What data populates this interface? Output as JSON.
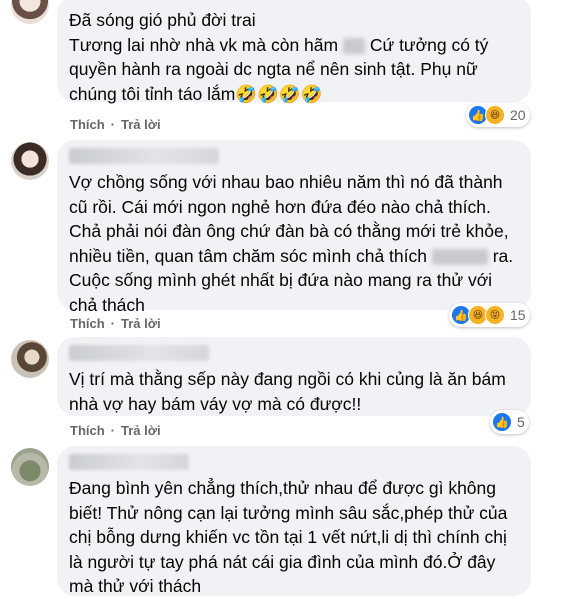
{
  "comments": [
    {
      "text_lines": [
        "Đã sóng gió phủ đời trai",
        "Tương lai nhờ nhà vk mà còn hãm",
        "Cứ tưởng có tý",
        "quyền hành ra ngoài dc ngta nể nên sinh tật. Phụ nữ",
        "chúng tôi tỉnh táo lắm🤣🤣🤣🤣"
      ],
      "like_label": "Thích",
      "reply_label": "Trả lời",
      "reaction_count": "20",
      "reactions": [
        "like-icon",
        "haha-icon"
      ]
    },
    {
      "text_lines": [
        "Vợ chồng sống với nhau bao nhiêu năm thì nó đã thành",
        "cũ rồi. Cái mới ngon nghẻ hơn đứa đéo nào chả thích.",
        "Chả phải nói đàn ông chứ đàn bà có thằng mới trẻ khỏe,",
        "nhiều tiền, quan tâm chăm sóc mình chả thích",
        "ra.",
        "Cuộc sống mình ghét nhất bị đứa nào mang ra thử với",
        "chả thách"
      ],
      "like_label": "Thích",
      "reply_label": "Trả lời",
      "reaction_count": "15",
      "reactions": [
        "like-icon",
        "haha-icon",
        "haha-icon"
      ]
    },
    {
      "text_lines": [
        "Vị trí mà thằng sếp này đang ngồi có khi củng là ăn bám",
        "nhà vợ hay bám váy vợ mà có được!!"
      ],
      "like_label": "Thích",
      "reply_label": "Trả lời",
      "reaction_count": "5",
      "reactions": [
        "like-icon"
      ]
    },
    {
      "text_lines": [
        "Đang bình yên chẳng thích,thử nhau để được gì không",
        "biết! Thử nông cạn lại tưởng mình sâu sắc,phép thử của",
        "chị bỗng dưng khiến vc tồn tại 1 vết nứt,li dị thì chính chị",
        "là người tự tay phá nát cái gia đình của mình đó.Ở đây",
        "mà thử với thách"
      ]
    }
  ],
  "colors": {
    "bubble": "#f0f2f5",
    "action_text": "#65676b",
    "like": "#1877f2",
    "haha": "#f7b125"
  }
}
